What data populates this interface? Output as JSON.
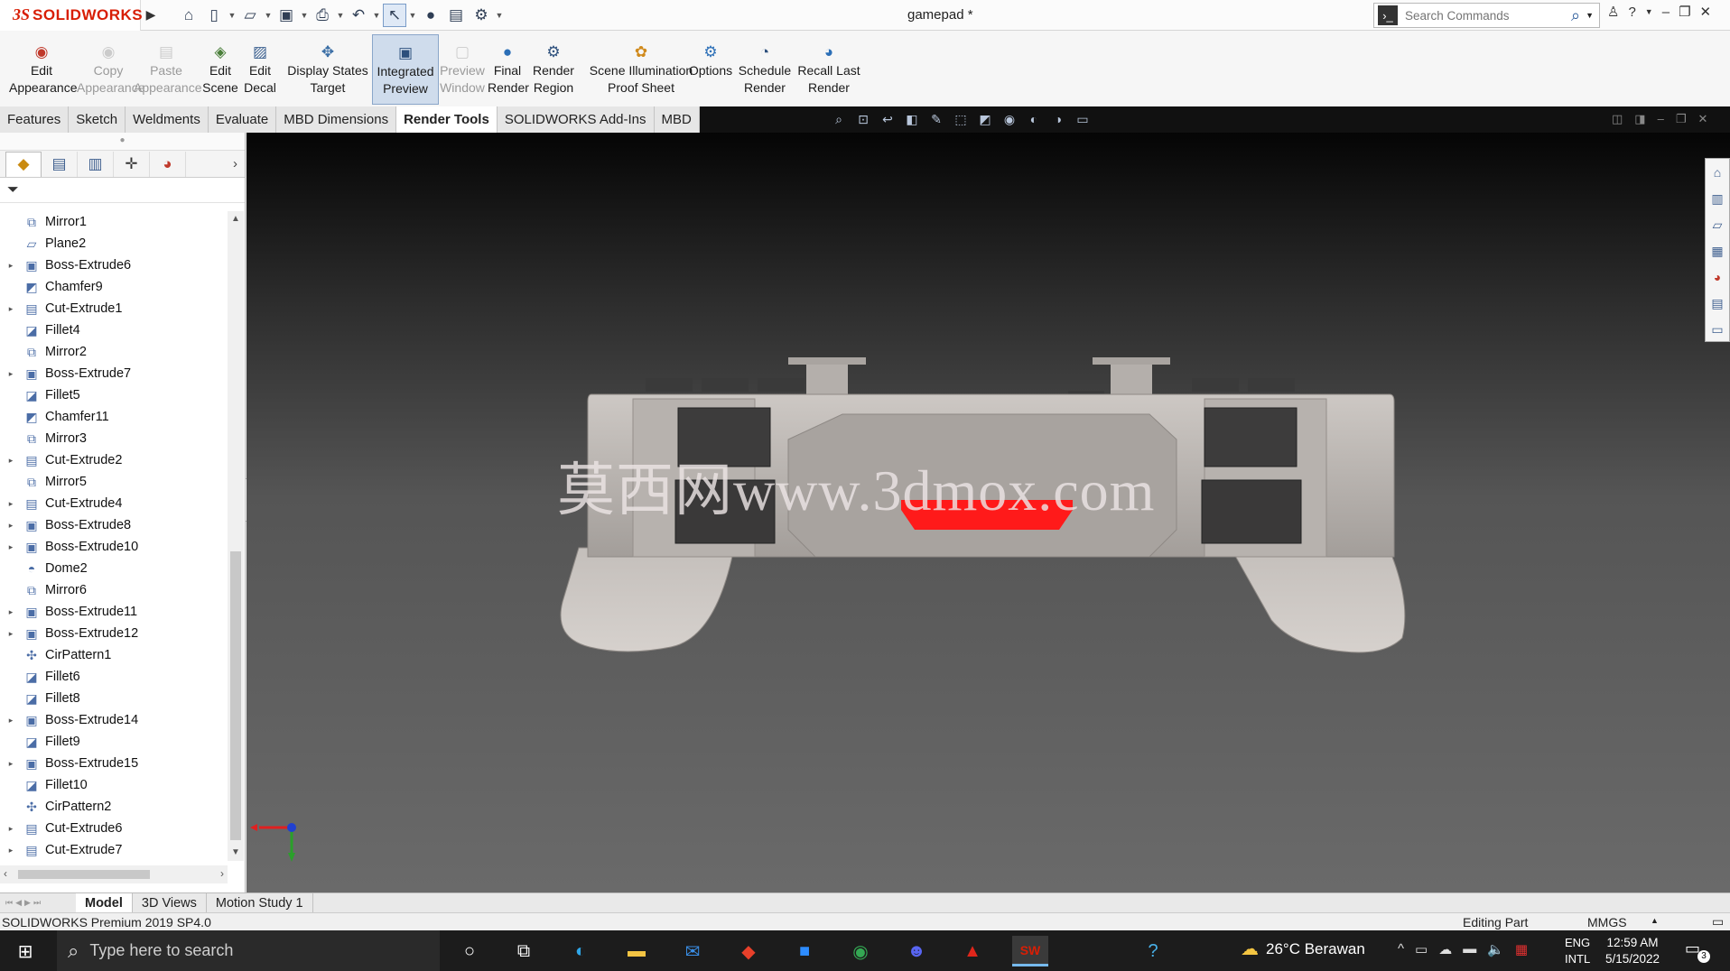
{
  "app": {
    "logo_ds": "3S",
    "logo_text": "SOLIDWORKS",
    "document_title": "gamepad *",
    "search_placeholder": "Search Commands"
  },
  "ribbon": {
    "tools": [
      {
        "label": "Edit\nAppearance",
        "icon": "appearance-icon",
        "glyph": "◉",
        "color": "#c0392b",
        "disabled": false,
        "active": false
      },
      {
        "label": "Copy\nAppearance",
        "icon": "copy-appearance-icon",
        "glyph": "◉",
        "color": "#999",
        "disabled": true,
        "active": false
      },
      {
        "label": "Paste\nAppearance",
        "icon": "paste-appearance-icon",
        "glyph": "▤",
        "color": "#999",
        "disabled": true,
        "active": false
      },
      {
        "label": "Edit\nScene",
        "icon": "scene-icon",
        "glyph": "◈",
        "color": "#4a7f3a",
        "disabled": false,
        "active": false
      },
      {
        "label": "Edit\nDecal",
        "icon": "decal-icon",
        "glyph": "▨",
        "color": "#3a5f8f",
        "disabled": false,
        "active": false
      },
      {
        "label": "Display States\nTarget",
        "icon": "display-states-icon",
        "glyph": "✥",
        "color": "#3a6ea5",
        "disabled": false,
        "active": false
      },
      {
        "label": "Integrated\nPreview",
        "icon": "integrated-preview-icon",
        "glyph": "▣",
        "color": "#2c4f7c",
        "disabled": false,
        "active": true
      },
      {
        "label": "Preview\nWindow",
        "icon": "preview-window-icon",
        "glyph": "▢",
        "color": "#999",
        "disabled": true,
        "active": false
      },
      {
        "label": "Final\nRender",
        "icon": "final-render-icon",
        "glyph": "●",
        "color": "#2c6fb7",
        "disabled": false,
        "active": false
      },
      {
        "label": "Render\nRegion",
        "icon": "render-region-icon",
        "glyph": "⚙",
        "color": "#2c4f7c",
        "disabled": false,
        "active": false
      },
      {
        "label": "Scene Illumination\nProof Sheet",
        "icon": "proof-sheet-icon",
        "glyph": "✿",
        "color": "#d08a1c",
        "disabled": false,
        "active": false
      },
      {
        "label": "Options",
        "icon": "options-icon",
        "glyph": "⚙",
        "color": "#2c6fb7",
        "disabled": false,
        "active": false
      },
      {
        "label": "Schedule\nRender",
        "icon": "schedule-render-icon",
        "glyph": "◔",
        "color": "#2c4f7c",
        "disabled": false,
        "active": false
      },
      {
        "label": "Recall Last\nRender",
        "icon": "recall-render-icon",
        "glyph": "◕",
        "color": "#2c6fb7",
        "disabled": false,
        "active": false
      }
    ]
  },
  "tabs": [
    {
      "label": "Features",
      "active": false
    },
    {
      "label": "Sketch",
      "active": false
    },
    {
      "label": "Weldments",
      "active": false
    },
    {
      "label": "Evaluate",
      "active": false
    },
    {
      "label": "MBD Dimensions",
      "active": false
    },
    {
      "label": "Render Tools",
      "active": true
    },
    {
      "label": "SOLIDWORKS Add-Ins",
      "active": false
    },
    {
      "label": "MBD",
      "active": false
    }
  ],
  "tree": {
    "items": [
      {
        "label": "Mirror1",
        "icon": "mirror-icon",
        "expandable": false
      },
      {
        "label": "Plane2",
        "icon": "plane-icon",
        "expandable": false
      },
      {
        "label": "Boss-Extrude6",
        "icon": "boss-extrude-icon",
        "expandable": true
      },
      {
        "label": "Chamfer9",
        "icon": "chamfer-icon",
        "expandable": false
      },
      {
        "label": "Cut-Extrude1",
        "icon": "cut-extrude-icon",
        "expandable": true
      },
      {
        "label": "Fillet4",
        "icon": "fillet-icon",
        "expandable": false
      },
      {
        "label": "Mirror2",
        "icon": "mirror-icon",
        "expandable": false
      },
      {
        "label": "Boss-Extrude7",
        "icon": "boss-extrude-icon",
        "expandable": true
      },
      {
        "label": "Fillet5",
        "icon": "fillet-icon",
        "expandable": false
      },
      {
        "label": "Chamfer11",
        "icon": "chamfer-icon",
        "expandable": false
      },
      {
        "label": "Mirror3",
        "icon": "mirror-icon",
        "expandable": false
      },
      {
        "label": "Cut-Extrude2",
        "icon": "cut-extrude-icon",
        "expandable": true
      },
      {
        "label": "Mirror5",
        "icon": "mirror-icon",
        "expandable": false
      },
      {
        "label": "Cut-Extrude4",
        "icon": "cut-extrude-icon",
        "expandable": true
      },
      {
        "label": "Boss-Extrude8",
        "icon": "boss-extrude-icon",
        "expandable": true
      },
      {
        "label": "Boss-Extrude10",
        "icon": "boss-extrude-icon",
        "expandable": true
      },
      {
        "label": "Dome2",
        "icon": "dome-icon",
        "expandable": false
      },
      {
        "label": "Mirror6",
        "icon": "mirror-icon",
        "expandable": false
      },
      {
        "label": "Boss-Extrude11",
        "icon": "boss-extrude-icon",
        "expandable": true
      },
      {
        "label": "Boss-Extrude12",
        "icon": "boss-extrude-icon",
        "expandable": true
      },
      {
        "label": "CirPattern1",
        "icon": "circular-pattern-icon",
        "expandable": false
      },
      {
        "label": "Fillet6",
        "icon": "fillet-icon",
        "expandable": false
      },
      {
        "label": "Fillet8",
        "icon": "fillet-icon",
        "expandable": false
      },
      {
        "label": "Boss-Extrude14",
        "icon": "boss-extrude-icon",
        "expandable": true
      },
      {
        "label": "Fillet9",
        "icon": "fillet-icon",
        "expandable": false
      },
      {
        "label": "Boss-Extrude15",
        "icon": "boss-extrude-icon",
        "expandable": true
      },
      {
        "label": "Fillet10",
        "icon": "fillet-icon",
        "expandable": false
      },
      {
        "label": "CirPattern2",
        "icon": "circular-pattern-icon",
        "expandable": false
      },
      {
        "label": "Cut-Extrude6",
        "icon": "cut-extrude-icon",
        "expandable": true
      },
      {
        "label": "Cut-Extrude7",
        "icon": "cut-extrude-icon",
        "expandable": true
      }
    ]
  },
  "viewport": {
    "watermark": "莫西网www.3dmox.com",
    "model_body_color": "#c7c3bf",
    "button_color": "#3b3b3b",
    "accent_red": "#ff1a1a"
  },
  "bottom_tabs": [
    {
      "label": "Model",
      "active": true
    },
    {
      "label": "3D Views",
      "active": false
    },
    {
      "label": "Motion Study 1",
      "active": false
    }
  ],
  "status": {
    "product": "SOLIDWORKS Premium 2019 SP4.0",
    "mode": "Editing Part",
    "units": "MMGS"
  },
  "taskbar": {
    "search_placeholder": "Type here to search",
    "weather": "26°C  Berawan",
    "lang_line1": "ENG",
    "lang_line2": "INTL",
    "time": "12:59 AM",
    "date": "5/15/2022",
    "notifications": "3",
    "apps": [
      {
        "name": "cortana-icon",
        "glyph": "○",
        "color": "#ffffff"
      },
      {
        "name": "task-view-icon",
        "glyph": "⧉",
        "color": "#ffffff"
      },
      {
        "name": "edge-icon",
        "glyph": "◐",
        "color": "#2fa6e8"
      },
      {
        "name": "file-explorer-icon",
        "glyph": "▬",
        "color": "#f3c443"
      },
      {
        "name": "mail-icon",
        "glyph": "✉",
        "color": "#3a8ee6"
      },
      {
        "name": "app-red-diamond-icon",
        "glyph": "◆",
        "color": "#e8402a"
      },
      {
        "name": "zoom-icon",
        "glyph": "■",
        "color": "#2d8cff"
      },
      {
        "name": "chrome-icon",
        "glyph": "◉",
        "color": "#34a853"
      },
      {
        "name": "discord-icon",
        "glyph": "☻",
        "color": "#5865f2"
      },
      {
        "name": "acrobat-icon",
        "glyph": "▲",
        "color": "#e0261b"
      },
      {
        "name": "solidworks-taskbar-icon",
        "glyph": "SW",
        "color": "#d81e05"
      },
      {
        "name": "help-icon",
        "glyph": "?",
        "color": "#48b0e8"
      }
    ]
  }
}
